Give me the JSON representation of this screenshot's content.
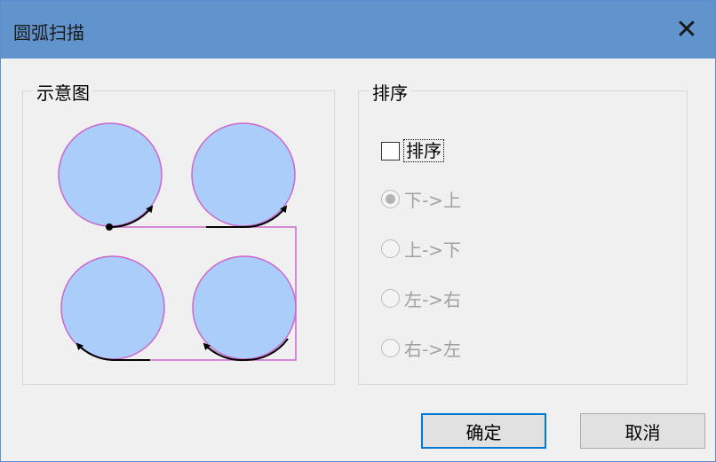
{
  "window": {
    "title": "圆弧扫描",
    "close_glyph": "✕"
  },
  "diagram_group": {
    "legend": "示意图"
  },
  "sort_group": {
    "legend": "排序",
    "checkbox_label": "排序",
    "checkbox_checked": false,
    "options": [
      {
        "label": "下->上",
        "selected": true,
        "enabled": false
      },
      {
        "label": "上->下",
        "selected": false,
        "enabled": false
      },
      {
        "label": "左->右",
        "selected": false,
        "enabled": false
      },
      {
        "label": "右->左",
        "selected": false,
        "enabled": false
      }
    ]
  },
  "buttons": {
    "ok": "确定",
    "cancel": "取消"
  },
  "colors": {
    "titlebar": "#6194cd",
    "circle_fill": "#aacdfa",
    "circle_stroke": "#cc66cc",
    "path_line": "#cc66cc",
    "default_button_border": "#0078d7"
  }
}
